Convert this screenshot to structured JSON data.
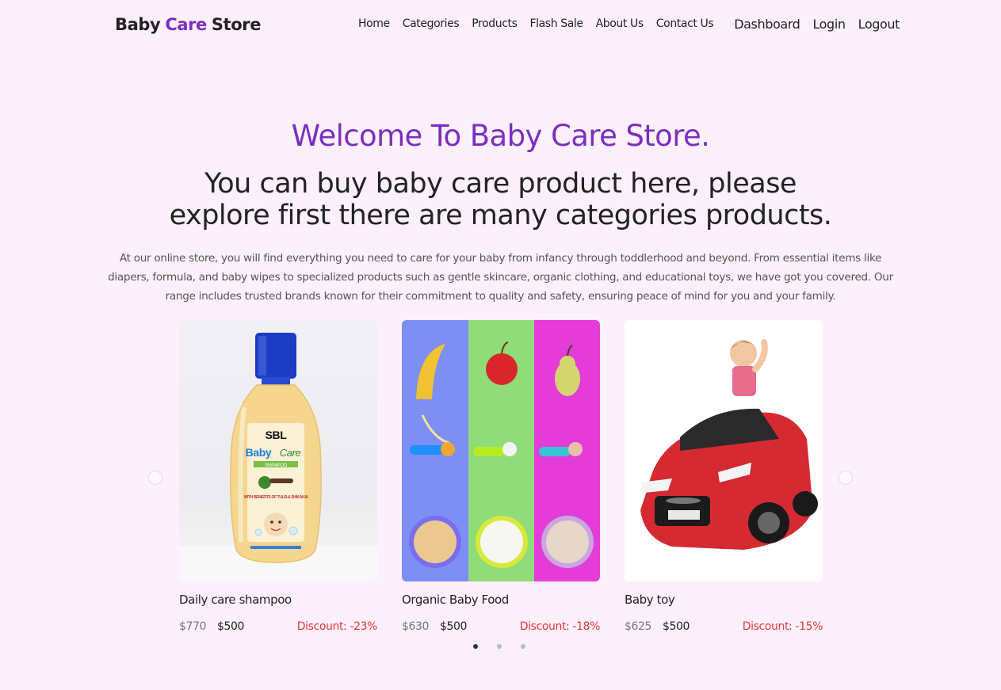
{
  "nav": {
    "brand": [
      "Baby",
      "Care",
      "Store"
    ],
    "links": [
      "Home",
      "Categories",
      "Products",
      "Flash Sale",
      "About Us",
      "Contact Us"
    ],
    "right_links": [
      "Dashboard",
      "Login",
      "Logout"
    ]
  },
  "hero": {
    "welcome": "Welcome To Baby Care Store.",
    "tagline": "You can buy baby care product here, please explore first there are many categories products.",
    "description": "At our online store, you will find everything you need to care for your baby from infancy through toddlerhood and beyond. From essential items like diapers, formula, and baby wipes to specialized products such as gentle skincare, organic clothing, and educational toys, we have got you covered. Our range includes trusted brands known for their commitment to quality and safety, ensuring peace of mind for you and your family."
  },
  "products": [
    {
      "title": "Daily care shampoo",
      "old_price": "$770",
      "new_price": "$500",
      "discount": "Discount: -23%",
      "image": "shampoo-bottle",
      "label_top": "SBL",
      "label_brand_a": "Baby",
      "label_brand_b": "Care",
      "label_sub": "SHAMPOO",
      "label_note": "WITH BENEFITS OF TULSI & SHIKAKAI"
    },
    {
      "title": "Organic Baby Food",
      "old_price": "$630",
      "new_price": "$500",
      "discount": "Discount: -18%",
      "image": "fruits-and-purees"
    },
    {
      "title": "Baby toy",
      "old_price": "$625",
      "new_price": "$500",
      "discount": "Discount: -15%",
      "image": "kid-in-red-toy-car"
    }
  ],
  "carousel": {
    "pages": 3,
    "active_page": 1
  },
  "colors": {
    "background": "#fdf0fd",
    "accent": "#7b2fbf",
    "discount": "#e53935"
  }
}
